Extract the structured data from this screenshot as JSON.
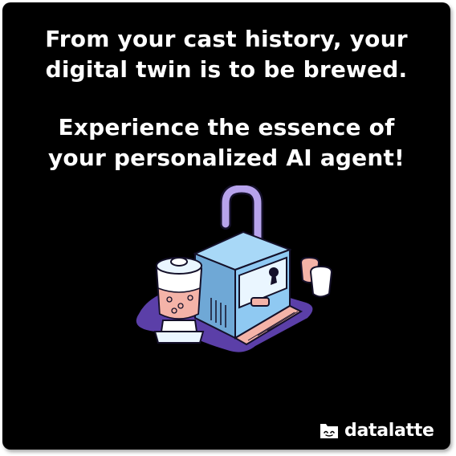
{
  "headline": {
    "line1": "From your cast history, your",
    "line2": "digital twin is to be brewed.",
    "line3": "Experience the essence of",
    "line4": "your personalized AI agent!"
  },
  "illustration": {
    "icon": "espresso-machine-illustration",
    "colors": {
      "body": "#8FC9F2",
      "handle": "#B7A3EC",
      "drip_tray": "#F4B3A8",
      "shadow": "#5B3FA8",
      "outline": "#141029"
    }
  },
  "brand": {
    "name": "datalatte",
    "icon": "datalatte-logo-icon"
  }
}
